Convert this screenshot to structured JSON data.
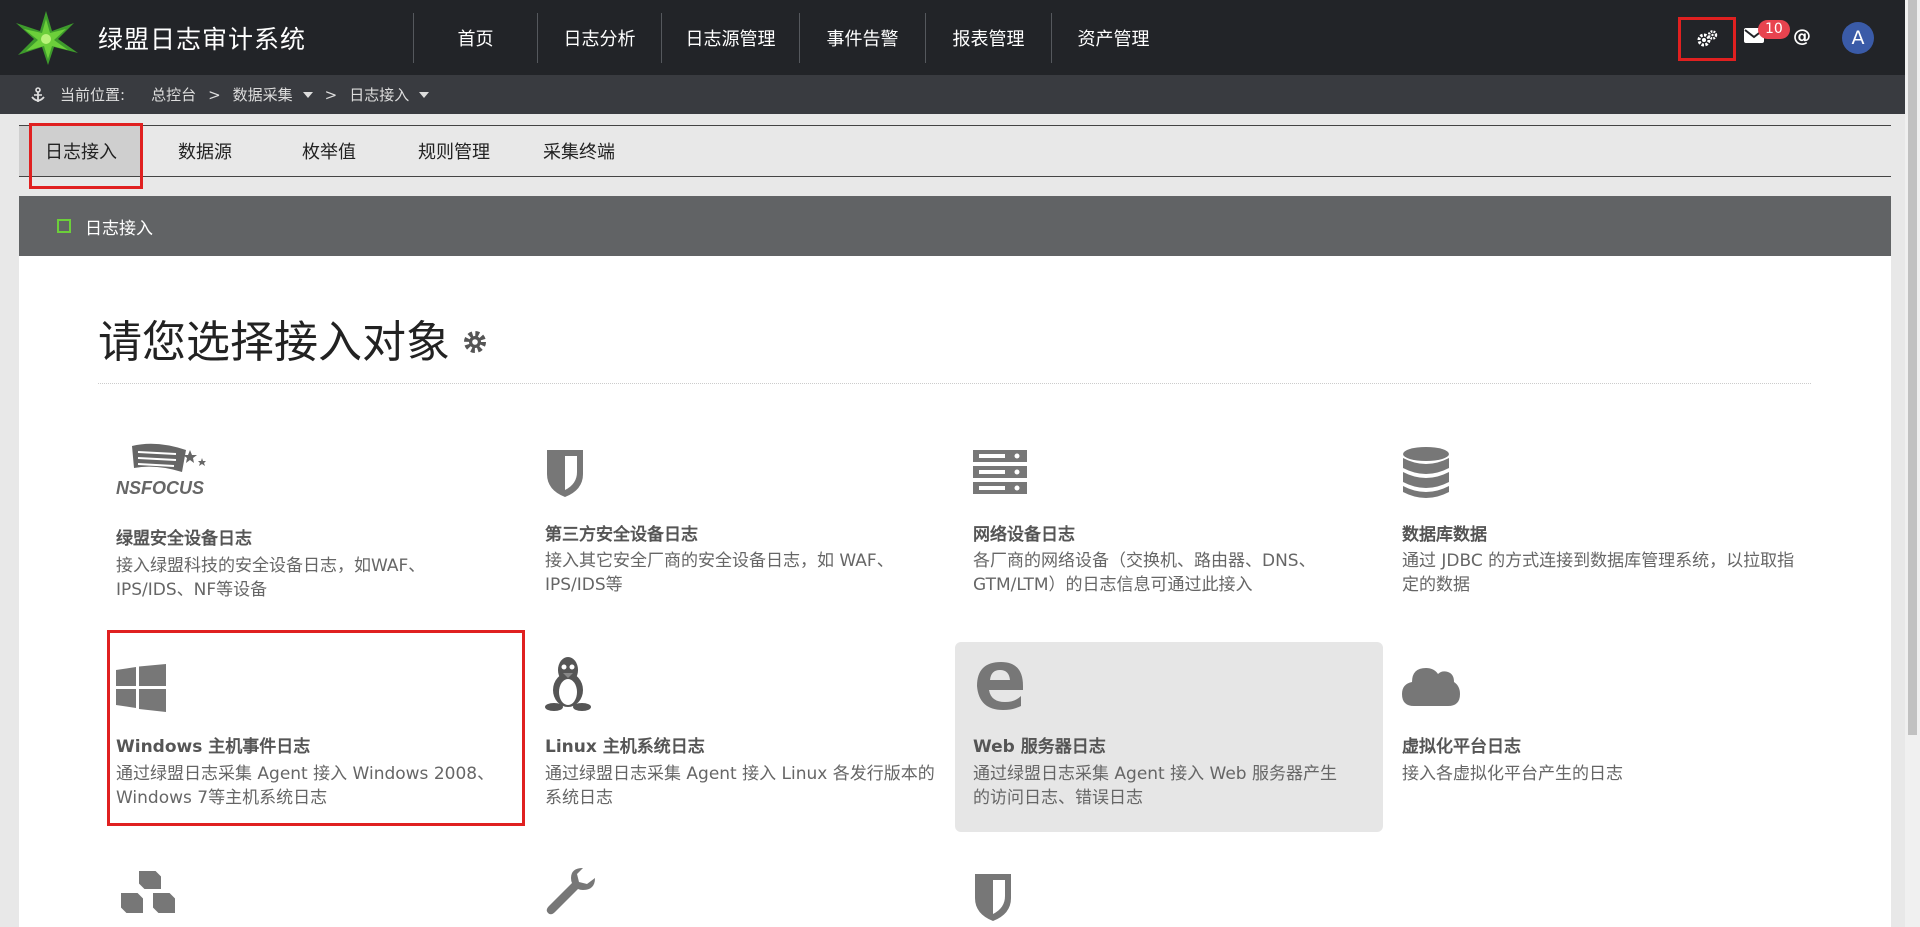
{
  "app": {
    "title": "绿盟日志审计系统"
  },
  "nav": [
    "首页",
    "日志分析",
    "日志源管理",
    "事件告警",
    "报表管理",
    "资产管理"
  ],
  "header_right": {
    "badge_count": "10",
    "at": "@",
    "avatar": "A"
  },
  "breadcrumb": {
    "prefix": "当前位置:",
    "items": [
      "总控台",
      "数据采集",
      "日志接入"
    ],
    "sep": ">"
  },
  "tabs": [
    "日志接入",
    "数据源",
    "枚举值",
    "规则管理",
    "采集终端"
  ],
  "panel": {
    "title": "日志接入",
    "heading": "请您选择接入对象"
  },
  "cards": [
    {
      "icon": "nsfocus-logo",
      "logo_text": "NSFOCUS",
      "title": "绿盟安全设备日志",
      "desc": "接入绿盟科技的安全设备日志，如WAF、IPS/IDS、NF等设备"
    },
    {
      "icon": "shield-icon",
      "title": "第三方安全设备日志",
      "desc": "接入其它安全厂商的安全设备日志，如 WAF、IPS/IDS等"
    },
    {
      "icon": "server-icon",
      "title": "网络设备日志",
      "desc": "各厂商的网络设备（交换机、路由器、DNS、GTM/LTM）的日志信息可通过此接入"
    },
    {
      "icon": "database-icon",
      "title": "数据库数据",
      "desc": "通过 JDBC 的方式连接到数据库管理系统，以拉取指定的数据"
    },
    {
      "icon": "windows-icon",
      "title": "Windows 主机事件日志",
      "desc": "通过绿盟日志采集 Agent 接入 Windows 2008、Windows 7等主机系统日志"
    },
    {
      "icon": "linux-icon",
      "title": "Linux 主机系统日志",
      "desc": "通过绿盟日志采集 Agent 接入 Linux 各发行版本的系统日志"
    },
    {
      "icon": "edge-icon",
      "title": "Web 服务器日志",
      "desc": "通过绿盟日志采集 Agent 接入 Web 服务器产生的访问日志、错误日志"
    },
    {
      "icon": "cloud-icon",
      "title": "虚拟化平台日志",
      "desc": "接入各虚拟化平台产生的日志"
    },
    {
      "icon": "cubes-icon",
      "title": "",
      "desc": ""
    },
    {
      "icon": "wrench-icon",
      "title": "",
      "desc": ""
    },
    {
      "icon": "shield-icon",
      "title": "",
      "desc": ""
    }
  ]
}
